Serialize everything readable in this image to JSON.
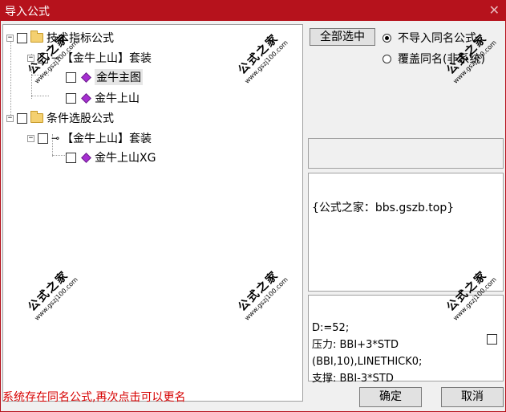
{
  "window": {
    "title": "导入公式",
    "close_icon": "close-icon"
  },
  "tree": {
    "nodes": [
      {
        "label": "技术指标公式",
        "type": "folder"
      },
      {
        "label": "【金牛上山】套装",
        "type": "key"
      },
      {
        "label": "金牛主图",
        "type": "gem"
      },
      {
        "label": "金牛上山",
        "type": "gem"
      },
      {
        "label": "条件选股公式",
        "type": "folder"
      },
      {
        "label": "【金牛上山】套装",
        "type": "key"
      },
      {
        "label": "金牛上山XG",
        "type": "gem"
      }
    ]
  },
  "options": {
    "select_all_label": "全部选中",
    "radio_no_import": "不导入同名公式",
    "radio_overwrite": "覆盖同名(非系统)",
    "selected": "不导入同名公式"
  },
  "info_text": "{公式之家：bbs.gszb.top}",
  "code_lines": [
    "D:=52;",
    "压力: BBI+3*STD",
    "(BBI,10),LINETHICK0;",
    "支撑: BBI-3*STD"
  ],
  "status_message": "系统存在同名公式,再次点击可以更名",
  "buttons": {
    "ok": "确定",
    "cancel": "取消"
  },
  "watermark": {
    "text": "公式之家",
    "url": "www.gszj100.com"
  }
}
